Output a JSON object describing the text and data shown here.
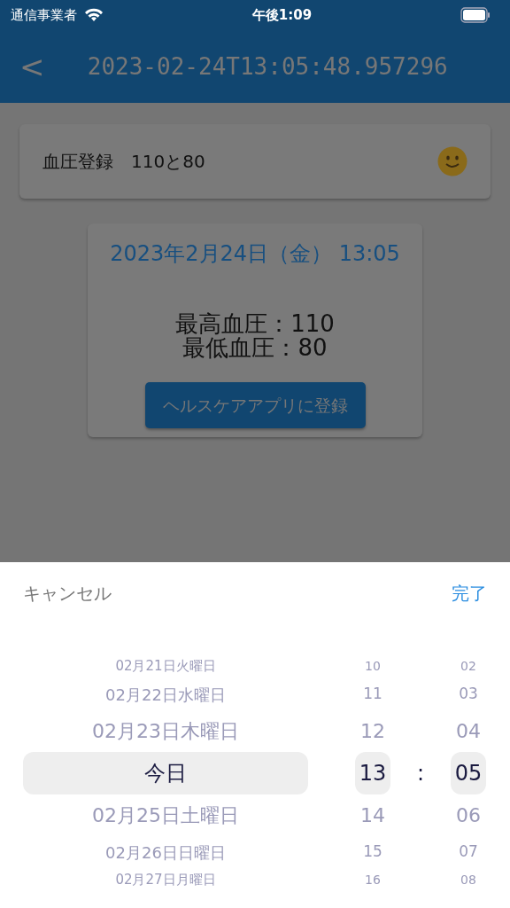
{
  "status_bar": {
    "carrier": "通信事業者",
    "time": "午後1:09"
  },
  "nav": {
    "back": "<",
    "title": "2023-02-24T13:05:48.957296"
  },
  "summary_card": {
    "text": "血圧登録　110と80"
  },
  "detail_card": {
    "datetime": "2023年2月24日（金） 13:05",
    "systolic": "最高血圧：110",
    "diastolic": "最低血圧：80",
    "button": "ヘルスケアアプリに登録"
  },
  "picker": {
    "cancel": "キャンセル",
    "done": "完了",
    "separator": ":",
    "dates": [
      {
        "label": "02月21日火曜日",
        "selected": false
      },
      {
        "label": "02月22日水曜日",
        "selected": false
      },
      {
        "label": "02月23日木曜日",
        "selected": false
      },
      {
        "label": "今日",
        "selected": true
      },
      {
        "label": "02月25日土曜日",
        "selected": false
      },
      {
        "label": "02月26日日曜日",
        "selected": false
      },
      {
        "label": "02月27日月曜日",
        "selected": false
      }
    ],
    "hours": [
      {
        "label": "10",
        "selected": false
      },
      {
        "label": "11",
        "selected": false
      },
      {
        "label": "12",
        "selected": false
      },
      {
        "label": "13",
        "selected": true
      },
      {
        "label": "14",
        "selected": false
      },
      {
        "label": "15",
        "selected": false
      },
      {
        "label": "16",
        "selected": false
      }
    ],
    "minutes": [
      {
        "label": "02",
        "selected": false
      },
      {
        "label": "03",
        "selected": false
      },
      {
        "label": "04",
        "selected": false
      },
      {
        "label": "05",
        "selected": true
      },
      {
        "label": "06",
        "selected": false
      },
      {
        "label": "07",
        "selected": false
      },
      {
        "label": "08",
        "selected": false
      }
    ]
  }
}
